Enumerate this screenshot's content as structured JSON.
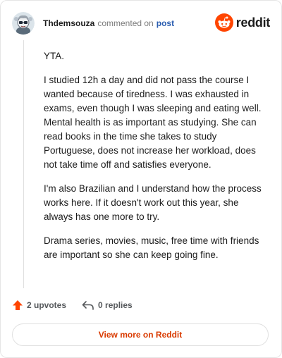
{
  "header": {
    "author": "Thdemsouza",
    "action": "commented on",
    "post_link": "post",
    "brand": "reddit",
    "brand_color": "#ff4500"
  },
  "comment": {
    "paragraphs": [
      "YTA.",
      "I studied 12h a day and did not pass the course I wanted because of tiredness. I was exhausted in exams, even though I was sleeping and eating well. Mental health is as important as studying. She can read books in the time she takes to study Portuguese, does not increase her workload, does not take time off and satisfies everyone.",
      "I'm also Brazilian and I understand how the process works here. If it doesn't work out this year, she always has one more to try.",
      "Drama series, movies, music, free time with friends are important so she can keep going fine."
    ]
  },
  "footer": {
    "upvotes": "2 upvotes",
    "replies": "0 replies",
    "view_more": "View more on Reddit",
    "upvote_icon": "upvote-arrow-icon",
    "reply_icon": "reply-arrow-icon",
    "accent_color": "#d93a00"
  }
}
